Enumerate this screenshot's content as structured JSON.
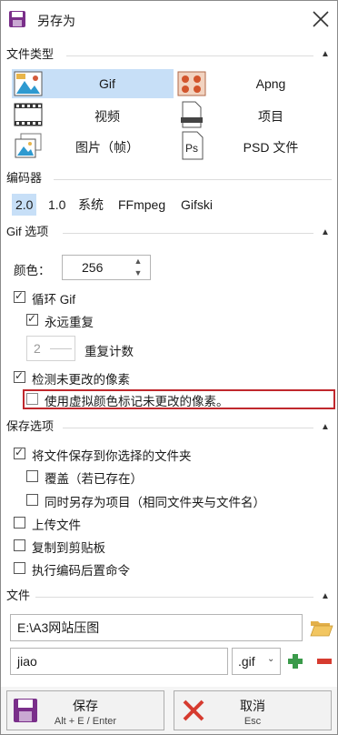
{
  "window": {
    "title": "另存为"
  },
  "file_type": {
    "heading": "文件类型",
    "items": [
      {
        "label": "Gif",
        "icon": "gif-image-icon",
        "selected": true
      },
      {
        "label": "Apng",
        "icon": "apng-image-icon",
        "selected": false
      },
      {
        "label": "视频",
        "icon": "video-film-icon",
        "selected": false
      },
      {
        "label": "项目",
        "icon": "project-file-icon",
        "selected": false
      },
      {
        "label": "图片（帧）",
        "icon": "image-frames-icon",
        "selected": false
      },
      {
        "label": "PSD 文件",
        "icon": "psd-icon",
        "selected": false
      }
    ]
  },
  "encoder": {
    "heading": "编码器",
    "tabs": [
      {
        "label": "2.0",
        "selected": true
      },
      {
        "label": "1.0",
        "selected": false
      },
      {
        "label": "系统",
        "selected": false
      },
      {
        "label": "FFmpeg",
        "selected": false
      },
      {
        "label": "Gifski",
        "selected": false
      }
    ]
  },
  "gif_options": {
    "heading": "Gif 选项",
    "colors_label": "颜色：",
    "colors_value": "256",
    "loop_label": "循环 Gif",
    "repeat_forever_label": "永远重复",
    "repeat_count_value": "2",
    "repeat_count_label": "重复计数",
    "detect_unchanged_label": "检测未更改的像素",
    "chroma_key_label": "使用虚拟颜色标记未更改的像素。"
  },
  "save_options": {
    "heading": "保存选项",
    "save_to_folder_label": "将文件保存到你选择的文件夹",
    "overwrite_label": "覆盖（若已存在）",
    "save_as_project_label": "同时另存为项目（相同文件夹与文件名）",
    "upload_label": "上传文件",
    "copy_clipboard_label": "复制到剪贴板",
    "post_command_label": "执行编码后置命令"
  },
  "file": {
    "heading": "文件",
    "folder_value": "E:\\A3网站压图",
    "filename_value": "jiao",
    "extension_value": ".gif"
  },
  "buttons": {
    "save_label": "保存",
    "save_shortcut": "Alt + E / Enter",
    "cancel_label": "取消",
    "cancel_shortcut": "Esc"
  },
  "colors": {
    "selection": "#c7dff7",
    "highlight_border": "#c0282d",
    "plus_green": "#3a9a4a",
    "minus_red": "#d63b2f",
    "save_purple": "#7a2f8a"
  }
}
